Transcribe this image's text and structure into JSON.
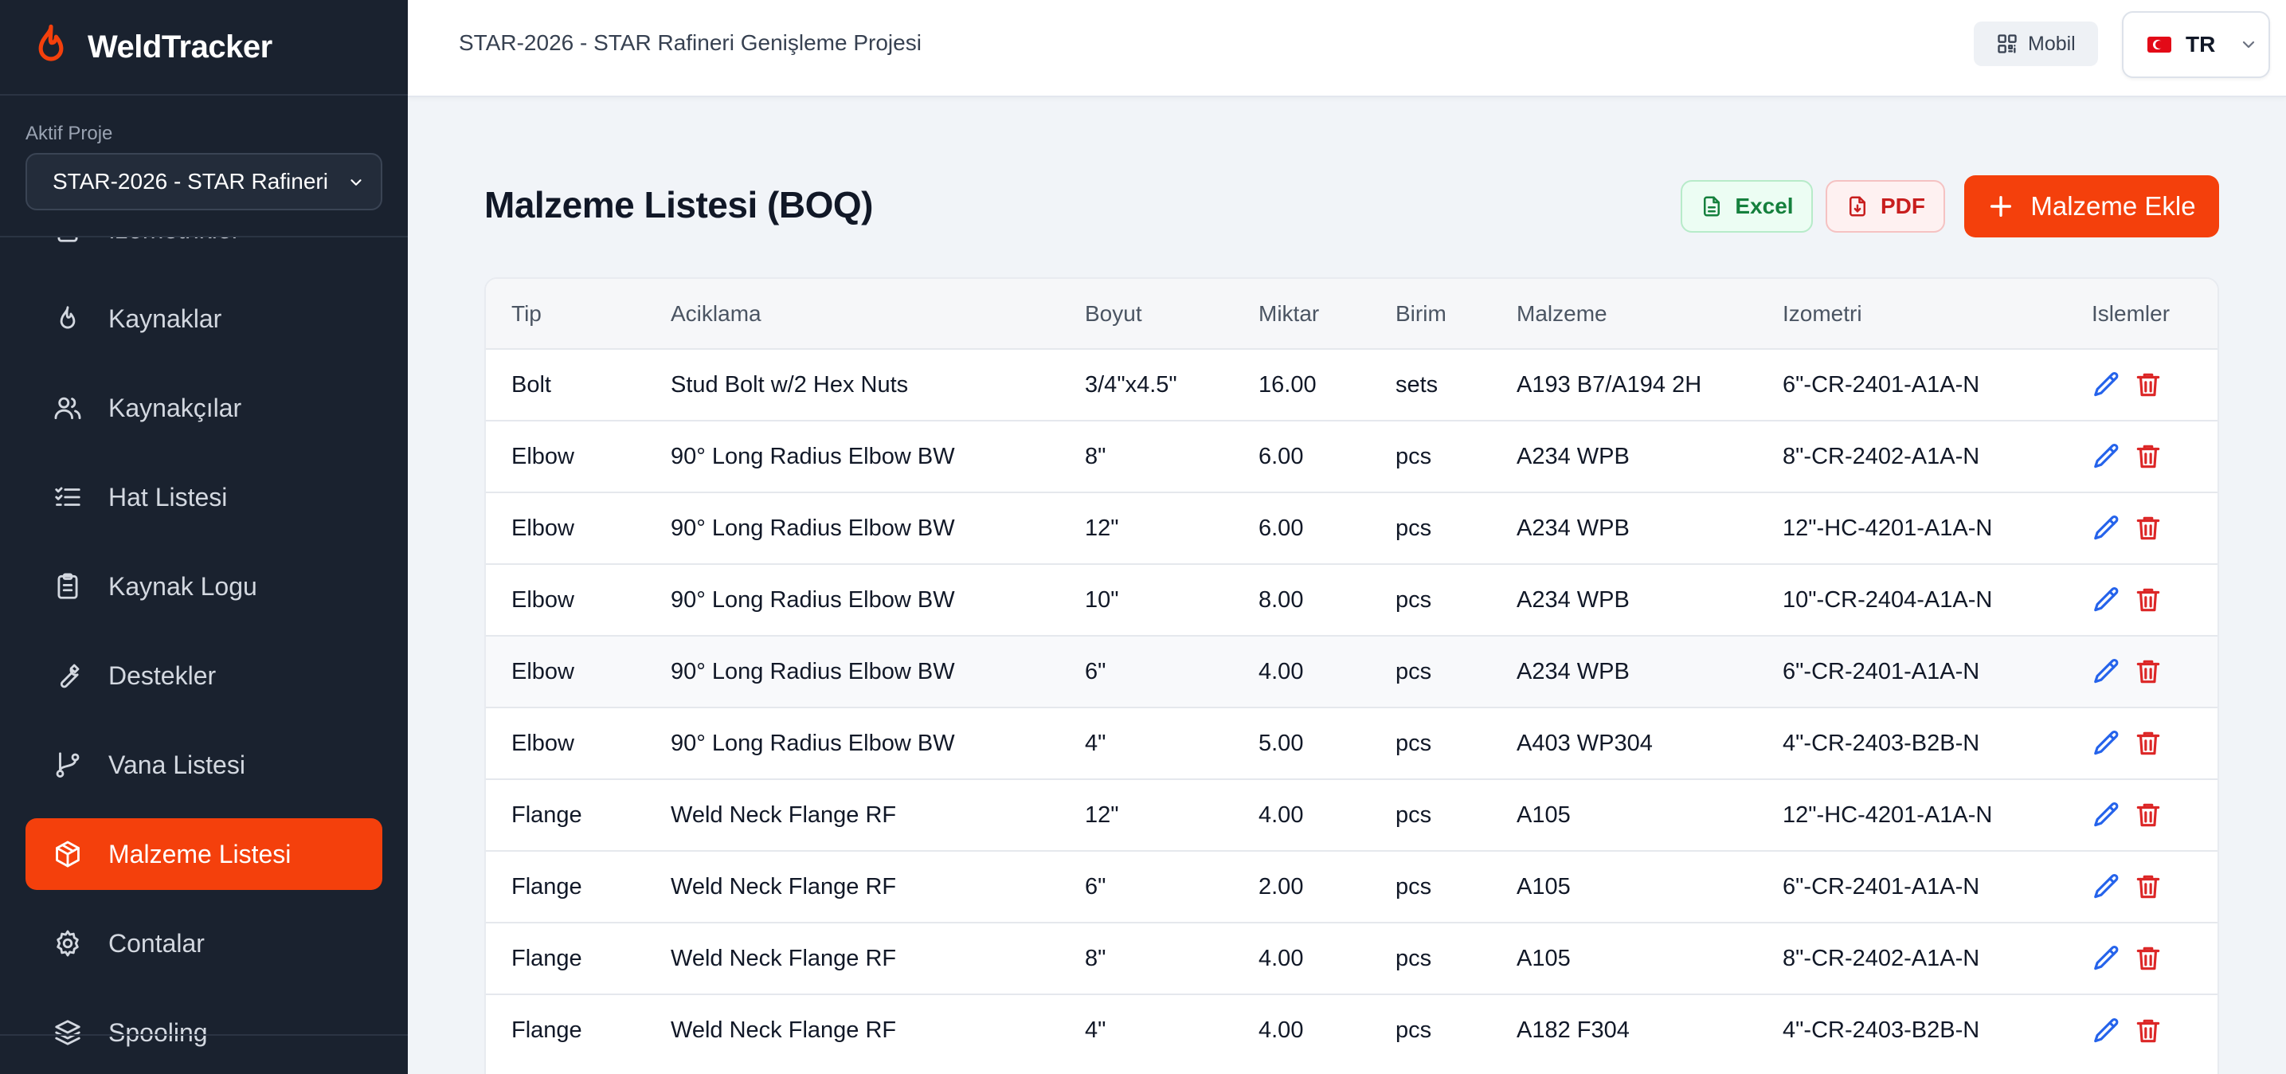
{
  "app": {
    "name": "WeldTracker"
  },
  "sidebar": {
    "project_label": "Aktif Proje",
    "project_value": "STAR-2026 - STAR Rafineri",
    "items": [
      {
        "label": "Izometrikler",
        "icon": "document-icon",
        "active": false
      },
      {
        "label": "Kaynaklar",
        "icon": "flame-icon",
        "active": false
      },
      {
        "label": "Kaynakçılar",
        "icon": "users-icon",
        "active": false
      },
      {
        "label": "Hat Listesi",
        "icon": "checklist-icon",
        "active": false
      },
      {
        "label": "Kaynak Logu",
        "icon": "clipboard-icon",
        "active": false
      },
      {
        "label": "Destekler",
        "icon": "wrench-icon",
        "active": false
      },
      {
        "label": "Vana Listesi",
        "icon": "branch-icon",
        "active": false
      },
      {
        "label": "Malzeme Listesi",
        "icon": "package-icon",
        "active": true
      },
      {
        "label": "Contalar",
        "icon": "gear-icon",
        "active": false
      },
      {
        "label": "Spooling",
        "icon": "layers-icon",
        "active": false
      }
    ]
  },
  "topbar": {
    "project_title": "STAR-2026 - STAR Rafineri Genişleme Projesi",
    "mobile_label": "Mobil",
    "language": "TR"
  },
  "page": {
    "title": "Malzeme Listesi (BOQ)",
    "excel_label": "Excel",
    "pdf_label": "PDF",
    "add_label": "Malzeme Ekle"
  },
  "table": {
    "columns": [
      "Tip",
      "Aciklama",
      "Boyut",
      "Miktar",
      "Birim",
      "Malzeme",
      "Izometri",
      "Islemler"
    ],
    "rows": [
      [
        "Bolt",
        "Stud Bolt w/2 Hex Nuts",
        "3/4\"x4.5\"",
        "16.00",
        "sets",
        "A193 B7/A194 2H",
        "6\"-CR-2401-A1A-N"
      ],
      [
        "Elbow",
        "90° Long Radius Elbow BW",
        "8\"",
        "6.00",
        "pcs",
        "A234 WPB",
        "8\"-CR-2402-A1A-N"
      ],
      [
        "Elbow",
        "90° Long Radius Elbow BW",
        "12\"",
        "6.00",
        "pcs",
        "A234 WPB",
        "12\"-HC-4201-A1A-N"
      ],
      [
        "Elbow",
        "90° Long Radius Elbow BW",
        "10\"",
        "8.00",
        "pcs",
        "A234 WPB",
        "10\"-CR-2404-A1A-N"
      ],
      [
        "Elbow",
        "90° Long Radius Elbow BW",
        "6\"",
        "4.00",
        "pcs",
        "A234 WPB",
        "6\"-CR-2401-A1A-N"
      ],
      [
        "Elbow",
        "90° Long Radius Elbow BW",
        "4\"",
        "5.00",
        "pcs",
        "A403 WP304",
        "4\"-CR-2403-B2B-N"
      ],
      [
        "Flange",
        "Weld Neck Flange RF",
        "12\"",
        "4.00",
        "pcs",
        "A105",
        "12\"-HC-4201-A1A-N"
      ],
      [
        "Flange",
        "Weld Neck Flange RF",
        "6\"",
        "2.00",
        "pcs",
        "A105",
        "6\"-CR-2401-A1A-N"
      ],
      [
        "Flange",
        "Weld Neck Flange RF",
        "8\"",
        "4.00",
        "pcs",
        "A105",
        "8\"-CR-2402-A1A-N"
      ],
      [
        "Flange",
        "Weld Neck Flange RF",
        "4\"",
        "4.00",
        "pcs",
        "A182 F304",
        "4\"-CR-2403-B2B-N"
      ]
    ]
  },
  "colors": {
    "accent": "#f4400c",
    "sidebar_bg": "#1a222f",
    "edit_icon": "#2563eb",
    "delete_icon": "#dc2626"
  }
}
